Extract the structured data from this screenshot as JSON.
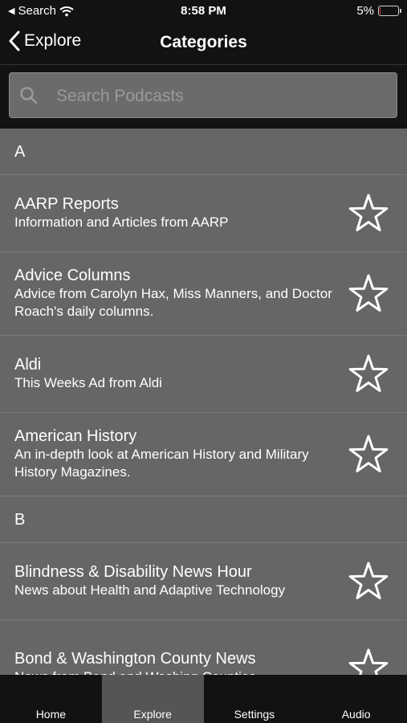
{
  "status": {
    "back_app": "Search",
    "time": "8:58 PM",
    "battery": "5%",
    "battery_level": 0.05
  },
  "nav": {
    "back_label": "Explore",
    "title": "Categories"
  },
  "search": {
    "placeholder": "Search Podcasts",
    "value": ""
  },
  "sections": [
    {
      "header": "A",
      "items": [
        {
          "title": "AARP Reports",
          "subtitle": "Information and Articles from AARP"
        },
        {
          "title": "Advice Columns",
          "subtitle": "Advice from Carolyn Hax, Miss Manners, and Doctor Roach's daily columns."
        },
        {
          "title": "Aldi",
          "subtitle": "This Weeks Ad from Aldi"
        },
        {
          "title": "American History",
          "subtitle": "An in-depth look at American History and Military History Magazines."
        }
      ]
    },
    {
      "header": "B",
      "items": [
        {
          "title": "Blindness & Disability News Hour",
          "subtitle": "News about Health and Adaptive Technology"
        },
        {
          "title": "Bond & Washington County News",
          "subtitle": "News from Bond and Washing Counties,"
        }
      ]
    }
  ],
  "tabs": [
    {
      "label": "Home",
      "active": false
    },
    {
      "label": "Explore",
      "active": true
    },
    {
      "label": "Settings",
      "active": false
    },
    {
      "label": "Audio",
      "active": false
    }
  ],
  "icons": {
    "search": "search-icon",
    "star": "star-outline-icon",
    "back": "chevron-left-icon",
    "wifi": "wifi-icon"
  }
}
